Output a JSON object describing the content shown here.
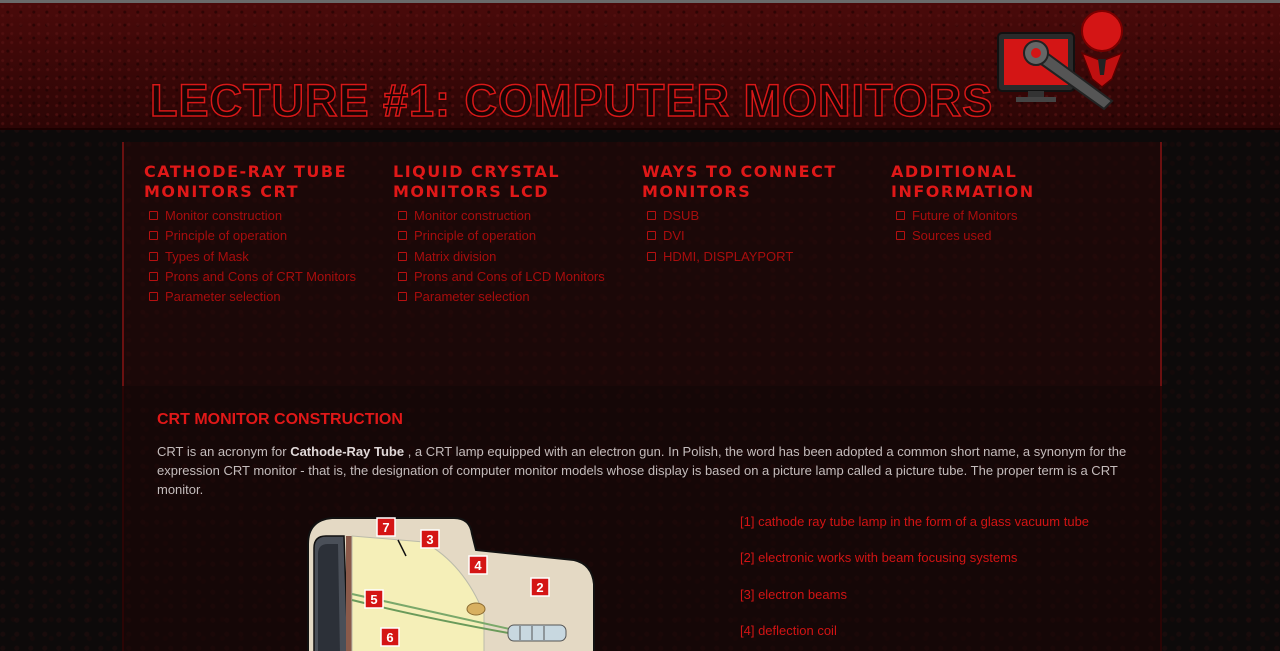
{
  "header": {
    "title": "LECTURE #1: COMPUTER MONITORS"
  },
  "nav": [
    {
      "heading_line1": "CATHODE-RAY TUBE",
      "heading_line2": "MONITORS CRT",
      "items": [
        "Monitor construction",
        "Principle of operation",
        "Types of Mask",
        "Prons and Cons of CRT Monitors",
        "Parameter selection"
      ]
    },
    {
      "heading_line1": "LIQUID CRYSTAL",
      "heading_line2": "MONITORS LCD",
      "items": [
        "Monitor construction",
        "Principle of operation",
        "Matrix division",
        "Prons and Cons of LCD Monitors",
        "Parameter selection"
      ]
    },
    {
      "heading_line1": "WAYS TO CONNECT",
      "heading_line2": "MONITORS",
      "items": [
        "DSUB",
        "DVI",
        "HDMI, DISPLAYPORT"
      ]
    },
    {
      "heading_line1": "ADDITIONAL",
      "heading_line2": "INFORMATION",
      "items": [
        "Future of Monitors",
        "Sources used"
      ]
    }
  ],
  "content": {
    "section_title": "CRT MONITOR CONSTRUCTION",
    "intro_before": "CRT is an acronym for ",
    "intro_bold": "Cathode-Ray Tube",
    "intro_after": " , a CRT lamp equipped with an electron gun. In Polish, the word has been adopted a common short name, a synonym for the expression CRT monitor - that is, the designation of computer monitor models whose display is based on a picture lamp called a picture tube. The proper term is a CRT monitor.",
    "diagram_markers": [
      "7",
      "3",
      "4",
      "2",
      "5",
      "6"
    ],
    "legend": [
      "[1] cathode ray tube lamp in the form of a glass vacuum tube",
      "[2] electronic works with beam focusing systems",
      "[3] electron beams",
      "[4] deflection coil"
    ]
  },
  "colors": {
    "accent_red": "#e01818",
    "link_red": "#a80d0d",
    "header_bg": "#3a0707",
    "page_bg": "#0d0a0a"
  }
}
